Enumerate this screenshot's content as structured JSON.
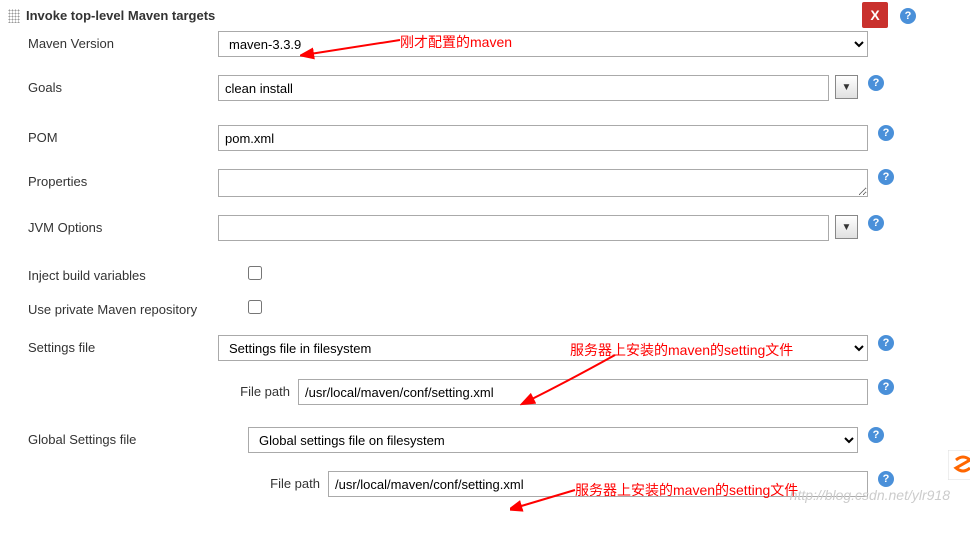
{
  "header": {
    "title": "Invoke top-level Maven targets",
    "close_label": "X"
  },
  "fields": {
    "maven_version": {
      "label": "Maven Version",
      "value": "maven-3.3.9"
    },
    "goals": {
      "label": "Goals",
      "value": "clean install"
    },
    "pom": {
      "label": "POM",
      "value": "pom.xml"
    },
    "properties": {
      "label": "Properties",
      "value": ""
    },
    "jvm_options": {
      "label": "JVM Options",
      "value": ""
    },
    "inject_build": {
      "label": "Inject build variables"
    },
    "private_repo": {
      "label": "Use private Maven repository"
    },
    "settings_file": {
      "label": "Settings file",
      "value": "Settings file in filesystem",
      "path_label": "File path",
      "path_value": "/usr/local/maven/conf/setting.xml"
    },
    "global_settings": {
      "label": "Global Settings file",
      "value": "Global settings file on filesystem",
      "path_label": "File path",
      "path_value": "/usr/local/maven/conf/setting.xml"
    }
  },
  "annotations": {
    "a1": "刚才配置的maven",
    "a2": "服务器上安装的maven的setting文件",
    "a3": "服务器上安装的maven的setting文件"
  },
  "watermark": "http://blog.csdn.net/ylr918"
}
